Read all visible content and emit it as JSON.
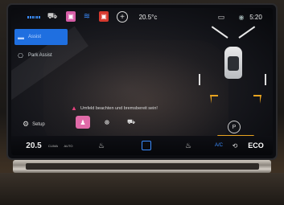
{
  "status_bar": {
    "temperature": "20.5°c",
    "time": "5:20"
  },
  "menu": {
    "items": [
      {
        "label": "Assist"
      },
      {
        "label": "Park Assist"
      }
    ],
    "setup_label": "Setup"
  },
  "warning": {
    "text": "Umfeld beachten und bremsbereit sein!"
  },
  "bottom_bar": {
    "temperature": "20.5",
    "clima_label": "CLIMA",
    "auto_label": "AUTO",
    "ac_label": "A/C",
    "eco_label": "ECO"
  },
  "icons": {
    "apps": "apps-grid-icon",
    "car": "car-icon",
    "seat": "seat-icon",
    "heat": "heat-icon",
    "plus": "plus-icon",
    "message": "message-icon",
    "park": "park-icon"
  },
  "colors": {
    "accent_blue": "#1f6fe0",
    "accent_pink": "#e06aa8",
    "parking_zone_orange": "#e8a320",
    "warning_pink": "#e0407a"
  }
}
